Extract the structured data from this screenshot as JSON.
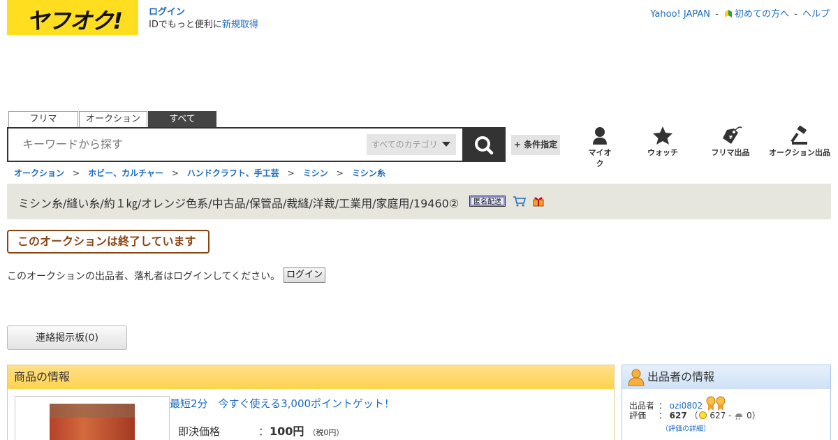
{
  "header": {
    "logo_text": "ヤフオク!",
    "login_link": "ログイン",
    "login_sub_prefix": "IDでもっと便利に",
    "signup_link": "新規取得",
    "top_links": {
      "yahoo": "Yahoo! JAPAN",
      "beginner": "初めての方へ",
      "help": "ヘルプ",
      "sep": "-"
    }
  },
  "search": {
    "tabs": [
      "フリマ",
      "オークション",
      "すべて"
    ],
    "active_tab": "すべて",
    "placeholder": "キーワードから探す",
    "category": "すべてのカテゴリ",
    "condition_button": "+ 条件指定"
  },
  "nav": {
    "items": [
      {
        "label": "マイオク",
        "icon": "user-icon"
      },
      {
        "label": "ウォッチ",
        "icon": "star-icon"
      },
      {
        "label": "フリマ出品",
        "icon": "price-tag-icon"
      },
      {
        "label": "オークション出品",
        "icon": "gavel-icon"
      }
    ]
  },
  "breadcrumb": [
    "オークション",
    "ホビー、カルチャー",
    "ハンドクラフト、手工芸",
    "ミシン",
    "ミシン糸"
  ],
  "breadcrumb_separator": ">",
  "item": {
    "title": "ミシン糸/縫い糸/約１㎏/オレンジ色系/中古品/保管品/裁縫/洋裁/工業用/家庭用/19460②",
    "badge_anonymous": "匿名配送"
  },
  "status": {
    "ended_notice": "このオークションは終了しています",
    "login_message": "このオークションの出品者、落札者はログインしてください。",
    "login_button": "ログイン"
  },
  "board_button": "連絡掲示板(0)",
  "product_info": {
    "header": "商品の情報",
    "promo": "最短2分　今すぐ使える3,000ポイントゲット！",
    "price_label": "即決価格",
    "colon": "：",
    "price_value": "100円",
    "price_tax": "（税0円）"
  },
  "seller_info": {
    "header": "出品者の情報",
    "seller_label": "出品者",
    "seller_name": "ozi0802",
    "rating_label": "評価",
    "colon": "：",
    "rating_total": "627",
    "rating_good": "627",
    "rating_bad": "0",
    "rating_detail": "（評価の詳細）"
  },
  "colors": {
    "brand_yellow": "#ffdd1f",
    "link_blue": "#1a6bbf",
    "ended_brown": "#8b4513"
  }
}
